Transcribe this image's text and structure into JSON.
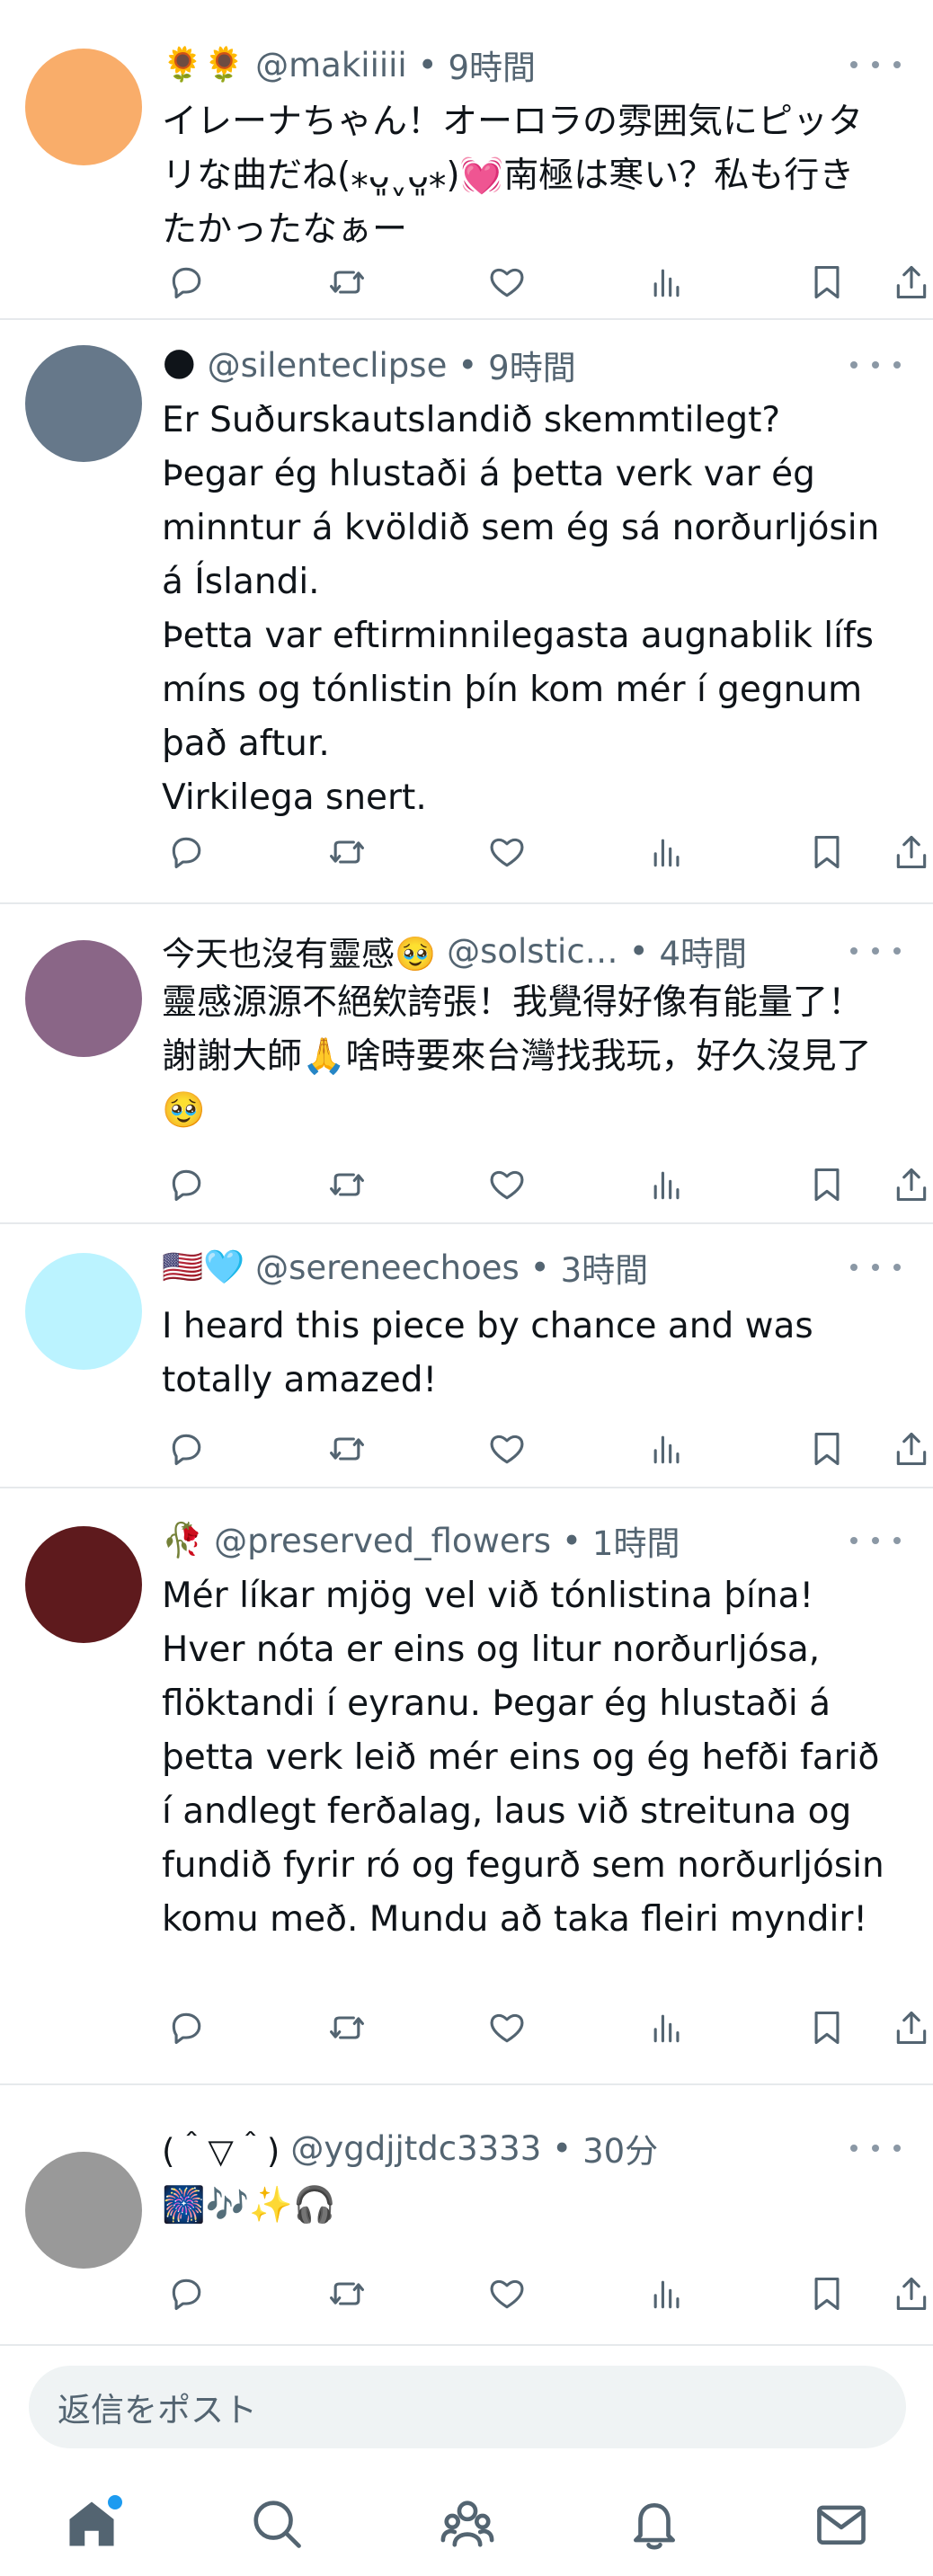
{
  "posts": [
    {
      "display_name": "🌻🌻",
      "handle": "@makiiiii",
      "separator": "•",
      "time": "9時間",
      "text": "イレーナちゃん！オーロラの雰囲気にピッタリな曲だね(⁎ᴗ͈ˬᴗ͈⁎)💓南極は寒い？私も行きたかったなぁー",
      "avatar_color": "#f9ad6a"
    },
    {
      "display_name": "🌑",
      "handle": "@silenteclipse",
      "separator": "•",
      "time": "9時間",
      "text": "Er Suðurskautslandið skemmtilegt?\nÞegar ég hlustaði á þetta verk var ég minntur á kvöldið sem ég sá norðurljósin á Íslandi.\nÞetta var eftirminnilegasta augnablik lífs míns og tónlistin þín kom mér í gegnum það aftur.\nVirkilega snert.",
      "avatar_color": "#66788a"
    },
    {
      "display_name": "今天也沒有靈感🥹",
      "handle": "@solstic…",
      "separator": "•",
      "time": "4時間",
      "text": "靈感源源不絕欸誇張！我覺得好像有能量了！謝謝大師🙏啥時要來台灣找我玩，好久沒見了🥹",
      "avatar_color": "#8a6687"
    },
    {
      "display_name": "🇺🇸🩵",
      "handle": "@sereneechoes",
      "separator": "•",
      "time": "3時間",
      "text": "I heard this piece by chance and was totally amazed!",
      "avatar_color": "#bbf3ff"
    },
    {
      "display_name": "🥀",
      "handle": "@preserved_flowers",
      "separator": "•",
      "time": "1時間",
      "text": "Mér líkar mjög vel við tónlistina þína! Hver nóta er eins og litur norðurljósa, flöktandi í eyranu. Þegar ég hlustaði á þetta verk leið mér eins og ég hefði farið í andlegt ferðalag, laus við streituna og fundið fyrir ró og fegurð sem norðurljósin komu með. Mundu að taka fleiri myndir!",
      "avatar_color": "#5e1a1d"
    },
    {
      "display_name": "(＾▽＾)",
      "handle": "@ygdjjtdc3333",
      "separator": "•",
      "time": "30分",
      "text": "🎆🎶✨🎧",
      "avatar_color": "#999999"
    }
  ],
  "reply_bar": {
    "placeholder": "返信をポスト"
  },
  "icons": {
    "actions": [
      "reply-icon",
      "repost-icon",
      "like-icon",
      "views-icon",
      "bookmark-icon",
      "share-icon"
    ],
    "nav": [
      "home-icon",
      "search-icon",
      "communities-icon",
      "notifications-icon",
      "messages-icon"
    ],
    "more": "more-icon"
  },
  "colors": {
    "text": "#0f1419",
    "secondary": "#536471",
    "divider": "#e6e9ec",
    "accent": "#1d9bf0"
  }
}
